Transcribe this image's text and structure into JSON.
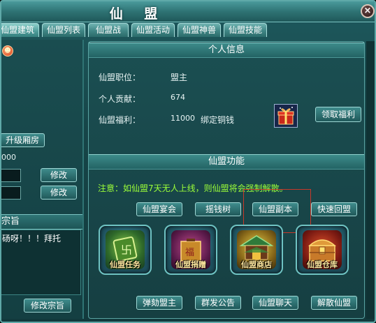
{
  "window": {
    "title": "仙 盟",
    "close_label": "×"
  },
  "tabs": [
    "仙盟建筑",
    "仙盟列表",
    "仙盟战",
    "仙盟活动",
    "仙盟神兽",
    "仙盟技能"
  ],
  "left_panel": {
    "upgrade_wing_button": "升级厢房",
    "zero_value": "000",
    "modify_button_1": "修改",
    "modify_button_2": "修改",
    "motto_header": "宗旨",
    "motto_text": "砀呀！！！拜托",
    "modify_motto_button": "修改宗旨"
  },
  "personal_info": {
    "header": "个人信息",
    "position_label": "仙盟职位：",
    "position_value": "盟主",
    "contribution_label": "个人贡献：",
    "contribution_value": "674",
    "welfare_label": "仙盟福利：",
    "welfare_value": "11000",
    "welfare_unit": "绑定铜钱",
    "claim_button": "领取福利"
  },
  "alliance_functions": {
    "header": "仙盟功能",
    "notice": "注意：如仙盟7天无人上线，则仙盟将会强制解散。",
    "buttons_row1": [
      "仙盟宴会",
      "摇钱树",
      "仙盟副本",
      "快速回盟"
    ],
    "feature_icons": [
      {
        "caption": "仙盟任务",
        "icon": "quest-scroll-icon",
        "color": "#3a8a3a"
      },
      {
        "caption": "仙盟捐赠",
        "icon": "donation-box-icon",
        "color": "#b06a1a"
      },
      {
        "caption": "仙盟商店",
        "icon": "shop-building-icon",
        "color": "#5a8a2a"
      },
      {
        "caption": "仙盟仓库",
        "icon": "treasure-chest-icon",
        "color": "#b03a1a"
      }
    ],
    "buttons_row2": [
      "弹劾盟主",
      "群发公告",
      "仙盟聊天",
      "解散仙盟"
    ]
  }
}
